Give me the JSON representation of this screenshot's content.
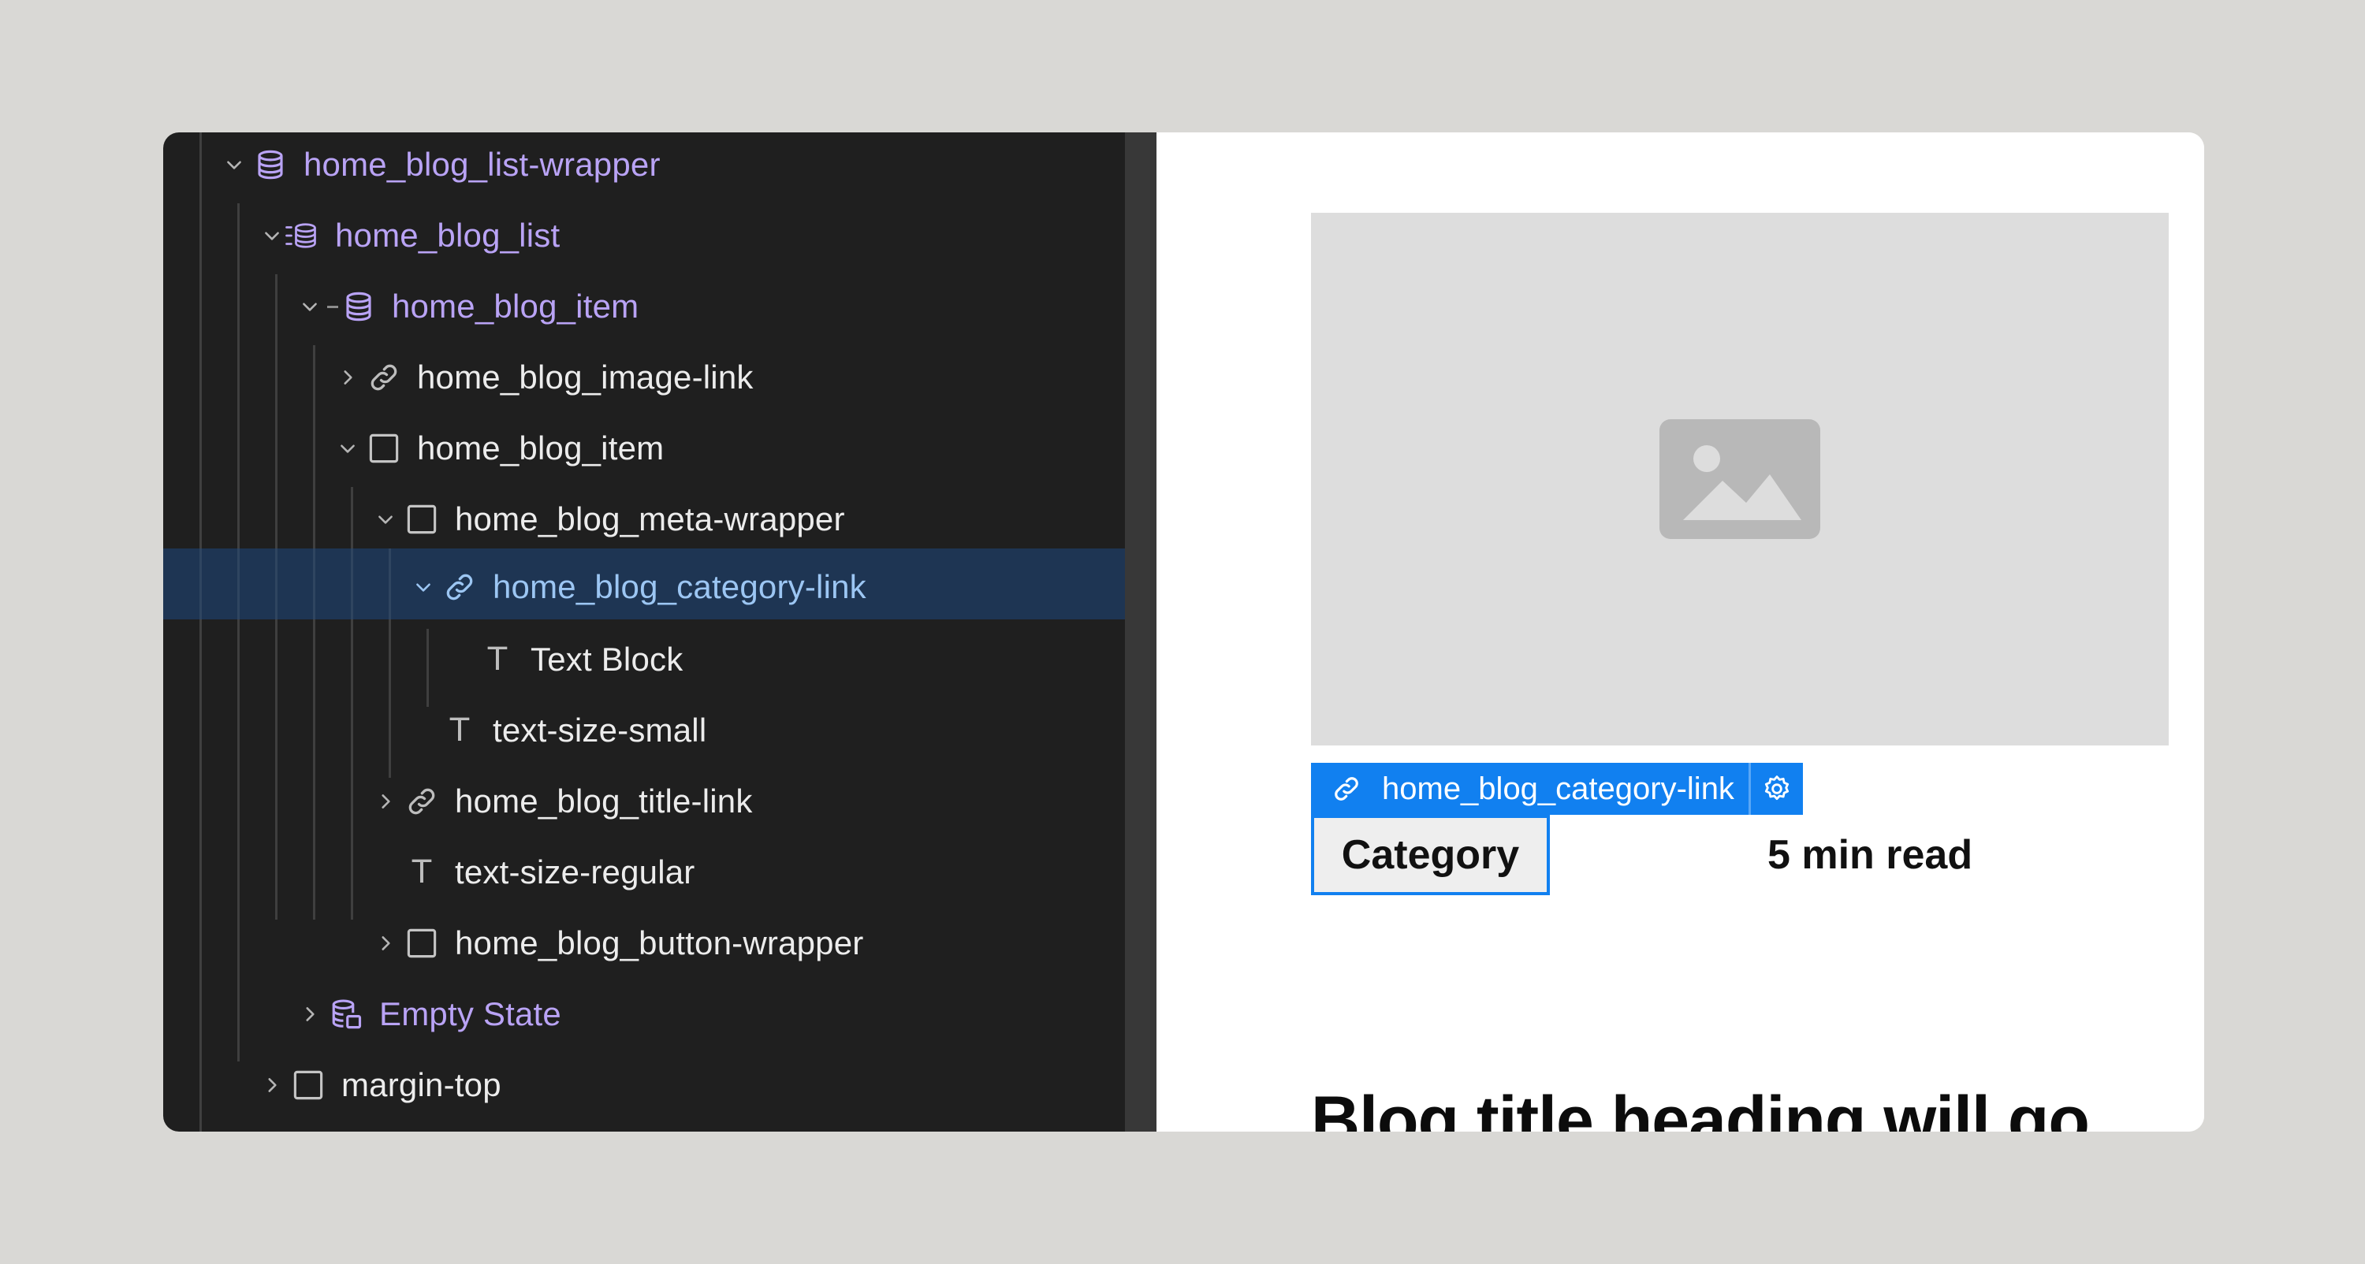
{
  "navigator": {
    "items": [
      {
        "label": "home_blog_list-wrapper",
        "icon": "collection-wrapper-icon",
        "expanded": true
      },
      {
        "label": "home_blog_list",
        "icon": "collection-list-icon",
        "expanded": true
      },
      {
        "label": "home_blog_item",
        "icon": "collection-item-icon",
        "expanded": true
      },
      {
        "label": "home_blog_image-link",
        "icon": "link-icon",
        "expanded": false
      },
      {
        "label": "home_blog_item",
        "icon": "div-block-icon",
        "expanded": true
      },
      {
        "label": "home_blog_meta-wrapper",
        "icon": "div-block-icon",
        "expanded": true
      },
      {
        "label": "home_blog_category-link",
        "icon": "link-icon",
        "expanded": true,
        "selected": true
      },
      {
        "label": "Text Block",
        "icon": "text-icon",
        "glyph": "T"
      },
      {
        "label": "text-size-small",
        "icon": "text-icon",
        "glyph": "T"
      },
      {
        "label": "home_blog_title-link",
        "icon": "link-icon",
        "expanded": false
      },
      {
        "label": "text-size-regular",
        "icon": "text-icon",
        "glyph": "T"
      },
      {
        "label": "home_blog_button-wrapper",
        "icon": "div-block-icon",
        "expanded": false
      },
      {
        "label": "Empty State",
        "icon": "empty-state-icon",
        "expanded": false
      },
      {
        "label": "margin-top",
        "icon": "div-block-icon",
        "expanded": false
      }
    ]
  },
  "canvas": {
    "selection_label": "home_blog_category-link",
    "category": "Category",
    "read_time": "5 min read",
    "title": "Blog title heading will go here"
  },
  "colors": {
    "panel_bg": "#1f1f1f",
    "selected_row": "#1e3553",
    "collection_text": "#b9a3f5",
    "selection_blue": "#1180f0",
    "image_placeholder": "#dddddd"
  }
}
